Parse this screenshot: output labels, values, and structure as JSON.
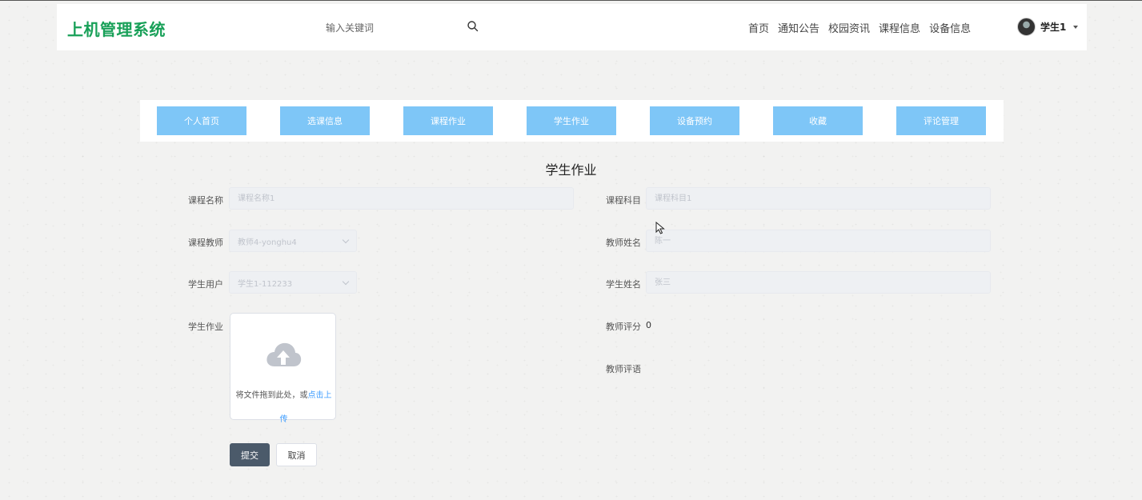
{
  "header": {
    "brand": "上机管理系统",
    "search_placeholder": "输入关键词",
    "nav": [
      "首页",
      "通知公告",
      "校园资讯",
      "课程信息",
      "设备信息"
    ],
    "user_name": "学生1"
  },
  "tabs": [
    "个人首页",
    "选课信息",
    "课程作业",
    "学生作业",
    "设备预约",
    "收藏",
    "评论管理"
  ],
  "page_title": "学生作业",
  "form": {
    "course_name_label": "课程名称",
    "course_name_placeholder": "课程名称1",
    "course_subject_label": "课程科目",
    "course_subject_placeholder": "课程科目1",
    "teacher_label": "课程教师",
    "teacher_value": "教师4-yonghu4",
    "teacher_name_label": "教师姓名",
    "teacher_name_placeholder": "陈一",
    "student_user_label": "学生用户",
    "student_user_value": "学生1-112233",
    "student_name_label": "学生姓名",
    "student_name_placeholder": "张三",
    "homework_label": "学生作业",
    "upload_text": "将文件拖到此处，或",
    "upload_link_a": "点击上",
    "upload_link_b": "传",
    "score_label": "教师评分",
    "score_value": "0",
    "comment_label": "教师评语",
    "submit_label": "提交",
    "cancel_label": "取消"
  },
  "colors": {
    "brand": "#18a058",
    "tab_bg": "#7ec6f7",
    "submit_bg": "#4b5a6a",
    "link": "#409eff"
  }
}
